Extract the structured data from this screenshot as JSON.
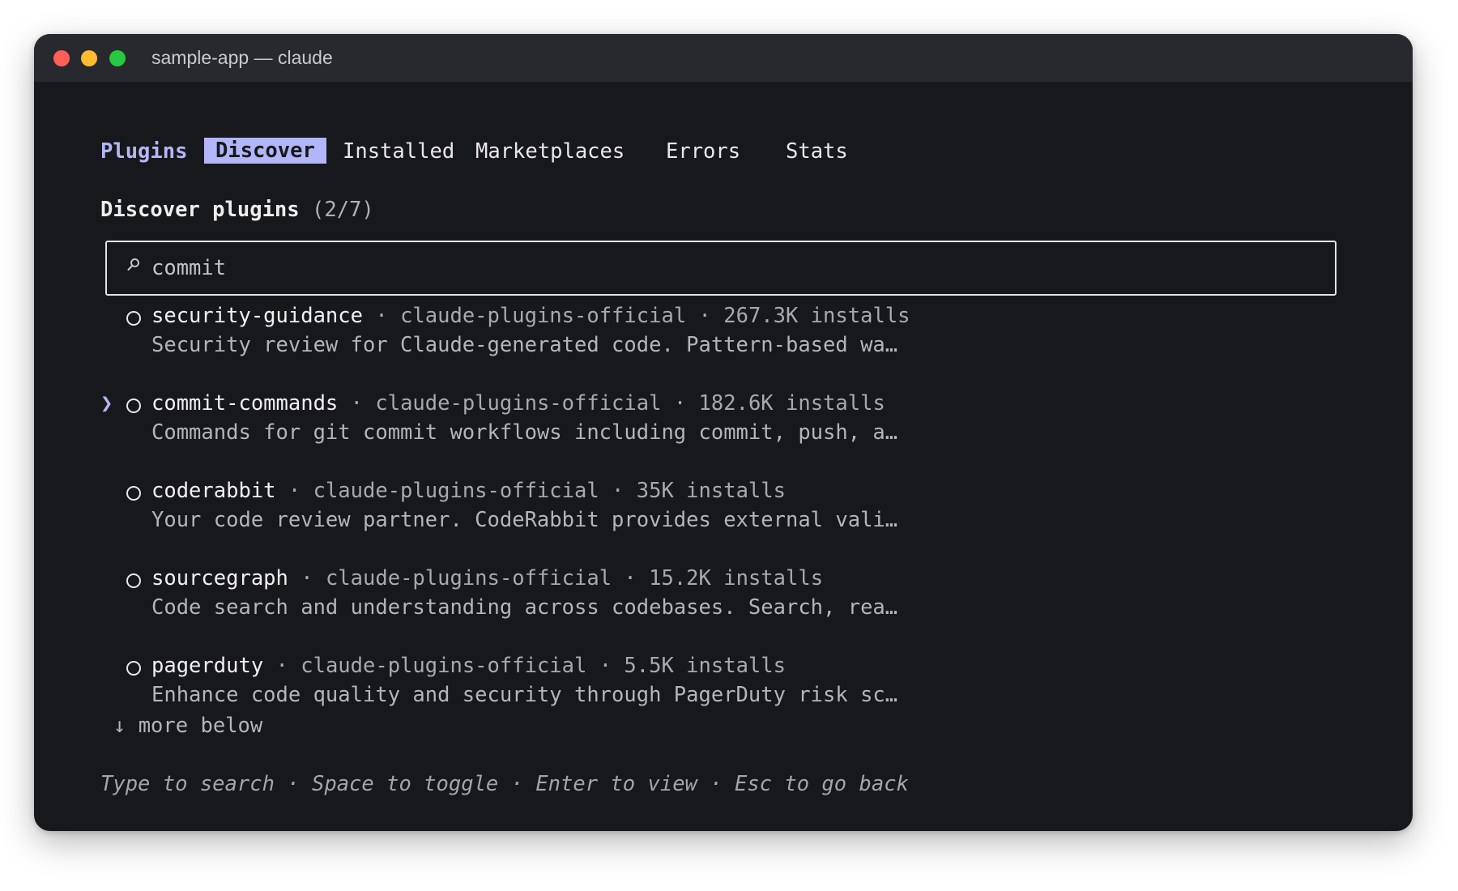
{
  "window": {
    "title": "sample-app — claude"
  },
  "tabs": {
    "brand": "Plugins",
    "items": [
      {
        "label": "Discover",
        "active": true
      },
      {
        "label": "Installed",
        "active": false
      },
      {
        "label": "Marketplaces",
        "active": false
      },
      {
        "label": "Errors",
        "active": false
      },
      {
        "label": "Stats",
        "active": false
      }
    ]
  },
  "section": {
    "title": "Discover plugins",
    "count": "(2/7)"
  },
  "search": {
    "value": "commit",
    "placeholder": ""
  },
  "plugins": [
    {
      "name": "security-guidance",
      "marketplace": "claude-plugins-official",
      "installs": "267.3K installs",
      "description": "Security review for Claude-generated code. Pattern-based wa…",
      "selected": false
    },
    {
      "name": "commit-commands",
      "marketplace": "claude-plugins-official",
      "installs": "182.6K installs",
      "description": "Commands for git commit workflows including commit, push, a…",
      "selected": true
    },
    {
      "name": "coderabbit",
      "marketplace": "claude-plugins-official",
      "installs": "35K installs",
      "description": "Your code review partner. CodeRabbit provides external vali…",
      "selected": false
    },
    {
      "name": "sourcegraph",
      "marketplace": "claude-plugins-official",
      "installs": "15.2K installs",
      "description": "Code search and understanding across codebases. Search, rea…",
      "selected": false
    },
    {
      "name": "pagerduty",
      "marketplace": "claude-plugins-official",
      "installs": "5.5K installs",
      "description": "Enhance code quality and security through PagerDuty risk sc…",
      "selected": false
    }
  ],
  "list": {
    "separator": " · ",
    "pointer": "❯",
    "more_below": "↓ more below"
  },
  "footer": {
    "hint": "Type to search · Space to toggle · Enter to view · Esc to go back"
  },
  "colors": {
    "accent": "#b2b6f8",
    "background": "#17181c",
    "titlebar": "#27292e"
  }
}
